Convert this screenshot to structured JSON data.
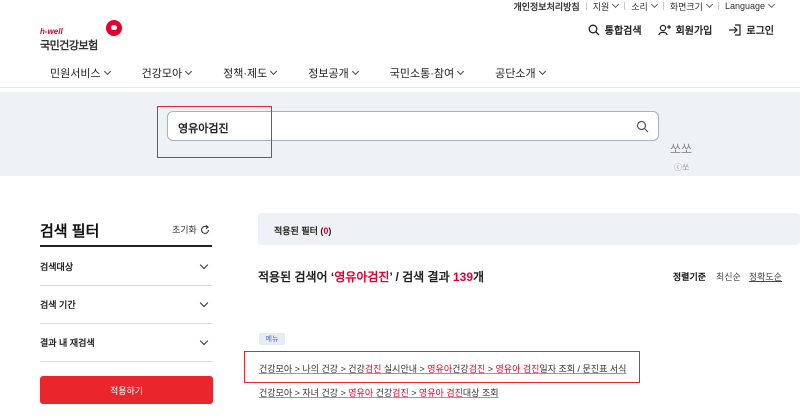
{
  "util_bar": {
    "privacy": "개인정보처리방침",
    "support": "지원",
    "sound": "소리",
    "zoom": "화면크기",
    "language": "Language"
  },
  "logo": {
    "small": "h-well",
    "main": "국민건강보험"
  },
  "header": {
    "search": "통합검색",
    "signup": "회원가입",
    "login": "로그인"
  },
  "nav": [
    "민원서비스",
    "건강모아",
    "정책·제도",
    "정보공개",
    "국민소통·참여",
    "공단소개"
  ],
  "search": {
    "value": "영유아검진"
  },
  "side": {
    "text": "쏘쏘",
    "sub": "ⓒ쏘"
  },
  "filter": {
    "title": "검색 필터",
    "reset": "초기화",
    "rows": [
      "검색대상",
      "검색 기간",
      "결과 내 재검색"
    ],
    "apply": "적용하기"
  },
  "results": {
    "applied_label": "적용된 필터 (",
    "applied_count": "0",
    "applied_close": ")",
    "head_prefix": "적용된 검색어 ‘",
    "keyword": "영유아검진",
    "head_mid": "’ / 검색 결과 ",
    "count": "139",
    "head_suffix": "개",
    "sort_label": "정렬기준",
    "sort_options": [
      "최신순",
      "정확도순"
    ],
    "badge": "메뉴",
    "link1": {
      "a": "건강모아 > 나의 건강 > 건강",
      "b": "검진",
      "c": " 실시안내 > ",
      "d": "영유아",
      "e": "건강",
      "f": "검진",
      "g": " > ",
      "h": "영유아 검진",
      "i": "일자 조회 / 문진표 서식"
    },
    "link2": {
      "a": "건강모아 > 자녀 건강 > ",
      "b": "영유아",
      "c": " 건강",
      "d": "검진",
      "e": " > ",
      "f": "영유아 검진",
      "g": "대상 조회"
    }
  },
  "colors": {
    "accent": "#e4002b",
    "band": "#eef1f6"
  }
}
